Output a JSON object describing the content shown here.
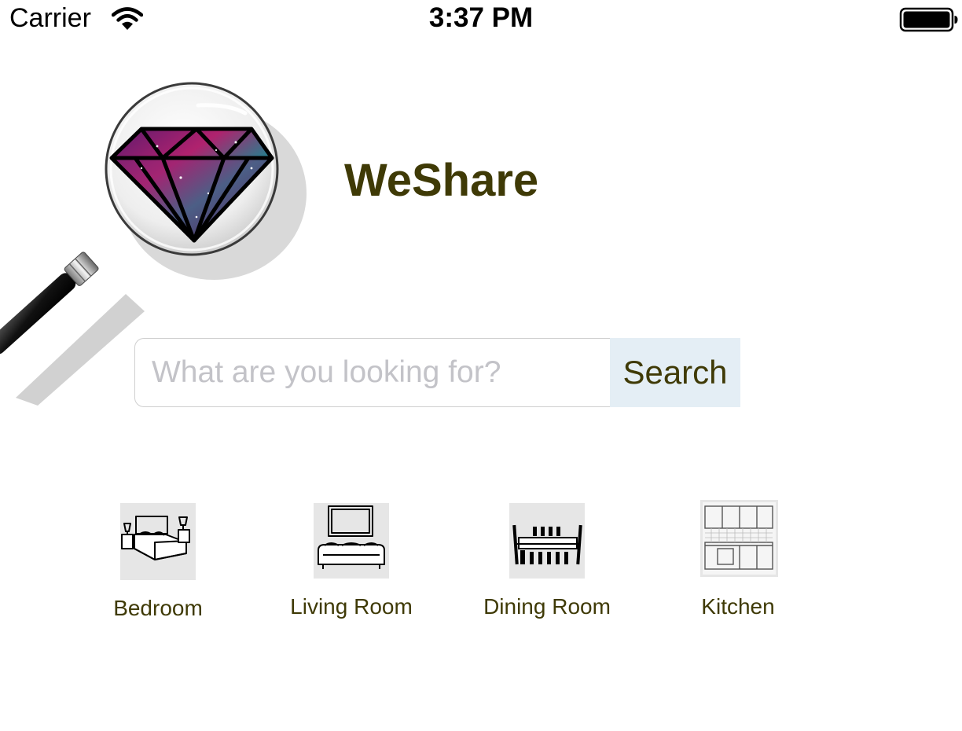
{
  "status_bar": {
    "carrier": "Carrier",
    "time": "3:37 PM",
    "icons": [
      "wifi-icon",
      "battery-icon"
    ]
  },
  "header": {
    "title": "WeShare",
    "logo_icon": "magnifying-glass-diamond-logo"
  },
  "search": {
    "placeholder": "What are you looking for?",
    "value": "",
    "button_label": "Search"
  },
  "categories": [
    {
      "label": "Bedroom",
      "icon": "bedroom-icon"
    },
    {
      "label": "Living Room",
      "icon": "living-room-icon"
    },
    {
      "label": "Dining Room",
      "icon": "dining-room-icon"
    },
    {
      "label": "Kitchen",
      "icon": "kitchen-icon"
    }
  ],
  "colors": {
    "title_text": "#3f3a06",
    "label_text": "#3f3a06",
    "search_button_bg": "#e4eef5",
    "placeholder_text": "#c3c3c8",
    "thumbnail_bg": "#e6e6e6"
  }
}
